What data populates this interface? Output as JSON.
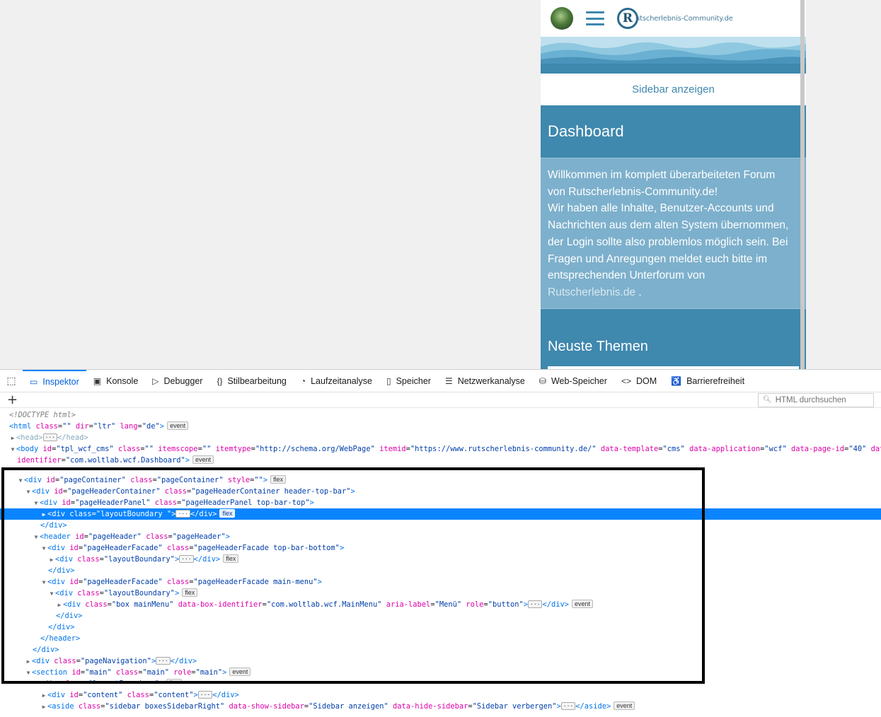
{
  "site": {
    "logo_letter": "R",
    "logo_text": "utscherlebnis-Community.de",
    "sidebar_toggle": "Sidebar anzeigen",
    "dashboard_title": "Dashboard",
    "welcome_lines": [
      "Willkommen im komplett überarbeiteten Forum",
      "von Rutscherlebnis-Community.de!",
      "Wir haben alle Inhalte, Benutzer-Accounts und",
      "Nachrichten aus dem alten System übernommen,",
      "der Login sollte also problemlos möglich sein. Bei",
      "Fragen und Anregungen meldet euch bitte im",
      "entsprechenden Unterforum von"
    ],
    "welcome_link": "Rutscherlebnis.de",
    "welcome_tail": " .",
    "neuste_title": "Neuste Themen",
    "colors": {
      "primary": "#3f88ae",
      "light": "#7db0cc"
    }
  },
  "devtools": {
    "tabs": [
      {
        "label": "Inspektor",
        "icon": "inspector-icon",
        "active": true
      },
      {
        "label": "Konsole",
        "icon": "console-icon"
      },
      {
        "label": "Debugger",
        "icon": "debugger-icon"
      },
      {
        "label": "Stilbearbeitung",
        "icon": "style-editor-icon"
      },
      {
        "label": "Laufzeitanalyse",
        "icon": "performance-icon"
      },
      {
        "label": "Speicher",
        "icon": "memory-icon"
      },
      {
        "label": "Netzwerkanalyse",
        "icon": "network-icon"
      },
      {
        "label": "Web-Speicher",
        "icon": "storage-icon"
      },
      {
        "label": "DOM",
        "icon": "dom-icon"
      },
      {
        "label": "Barrierefreiheit",
        "icon": "accessibility-icon"
      }
    ],
    "search_placeholder": "HTML durchsuchen",
    "badges": {
      "event": "event",
      "flex": "flex"
    }
  }
}
